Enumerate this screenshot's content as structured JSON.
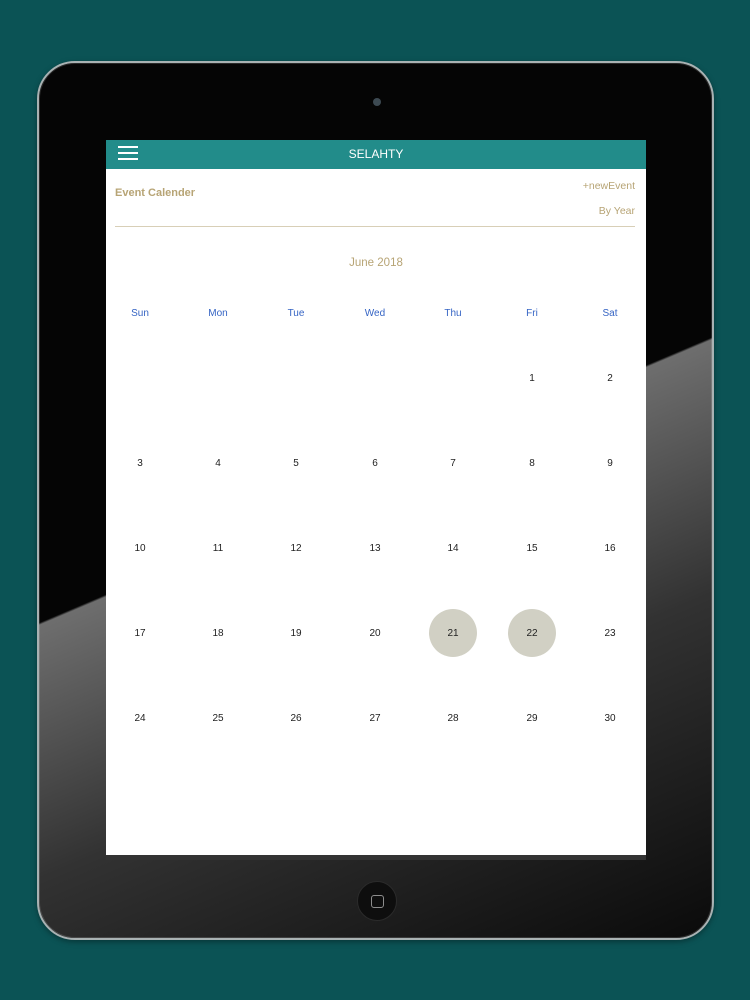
{
  "app": {
    "title": "SELAHTY"
  },
  "header": {
    "title": "Event Calender",
    "new_event": "+newEvent",
    "by_year": "By Year"
  },
  "calendar": {
    "month": "June 2018",
    "weekdays": [
      "Sun",
      "Mon",
      "Tue",
      "Wed",
      "Thu",
      "Fri",
      "Sat"
    ],
    "weeks": [
      [
        "",
        "",
        "",
        "",
        "",
        "1",
        "2"
      ],
      [
        "3",
        "4",
        "5",
        "6",
        "7",
        "8",
        "9"
      ],
      [
        "10",
        "11",
        "12",
        "13",
        "14",
        "15",
        "16"
      ],
      [
        "17",
        "18",
        "19",
        "20",
        "21",
        "22",
        "23"
      ],
      [
        "24",
        "25",
        "26",
        "27",
        "28",
        "29",
        "30"
      ]
    ],
    "highlighted_days": [
      "21",
      "22"
    ]
  },
  "colors": {
    "background": "#0b5355",
    "appbar": "#228c8a",
    "accent_text": "#b7a475",
    "weekday_text": "#3564c4",
    "highlight": "#d1d0c4"
  }
}
